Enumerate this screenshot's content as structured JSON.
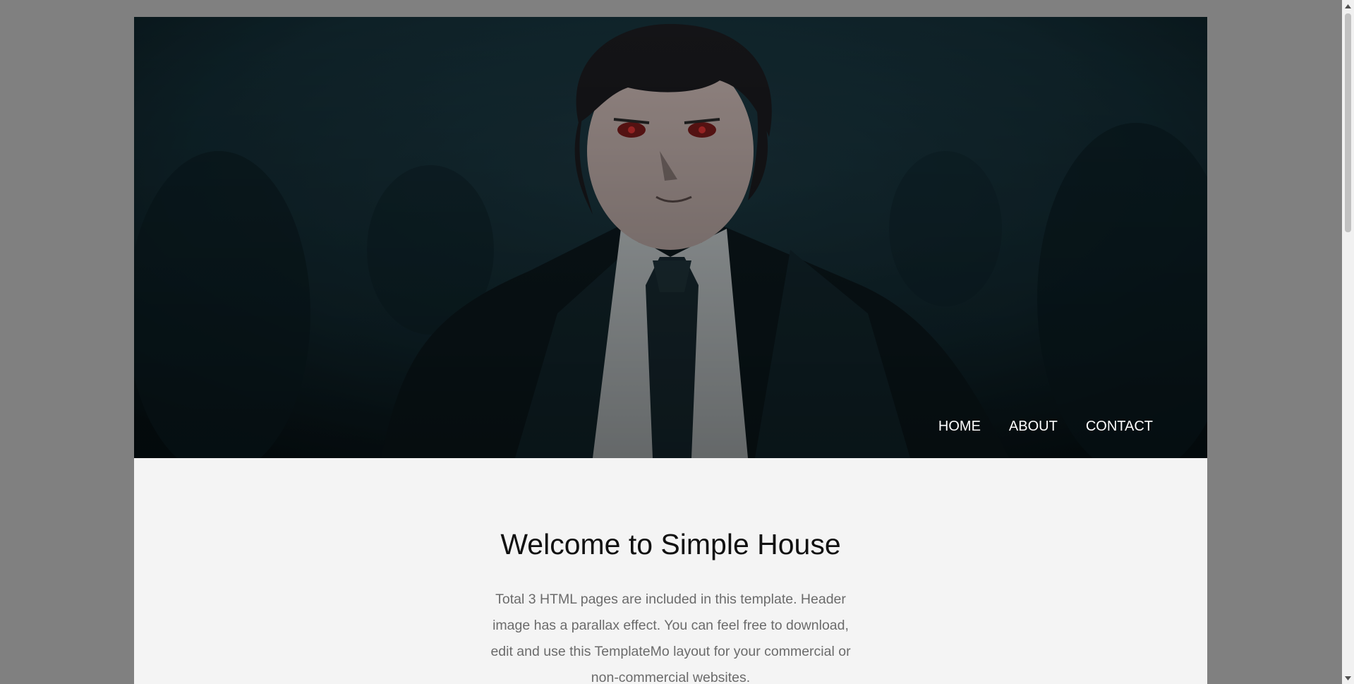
{
  "nav": {
    "items": [
      {
        "label": "HOME"
      },
      {
        "label": "ABOUT"
      },
      {
        "label": "CONTACT"
      }
    ]
  },
  "main": {
    "title": "Welcome to Simple House",
    "intro": "Total 3 HTML pages are included in this template. Header image has a parallax effect. You can feel free to download, edit and use this TemplateMo layout for your commercial or non-commercial websites."
  },
  "colors": {
    "page_background": "#808080",
    "content_background": "#f4f4f4",
    "nav_text": "#ffffff",
    "title_text": "#111111",
    "body_text": "#6b6b6b"
  },
  "icons": {
    "scroll_up": "triangle-up",
    "scroll_down": "triangle-down"
  }
}
